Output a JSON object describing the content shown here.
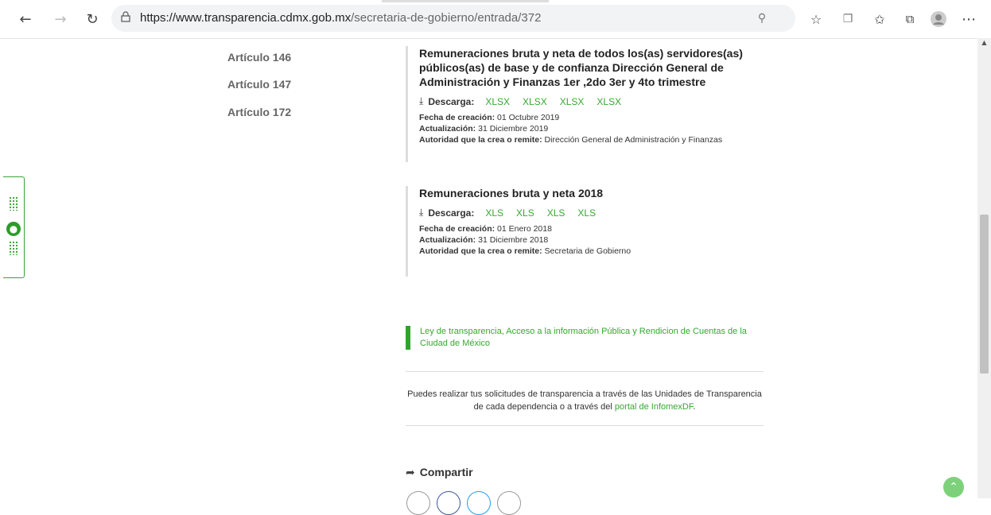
{
  "browser": {
    "url_domain": "https://www.transparencia.cdmx.gob.mx",
    "url_path": "/secretaria-de-gobierno/entrada/372"
  },
  "sidebar": {
    "items": [
      {
        "label": "Artículo 146"
      },
      {
        "label": "Artículo 147"
      },
      {
        "label": "Artículo 172"
      }
    ]
  },
  "documents": [
    {
      "title": "Remuneraciones bruta y neta de todos los(as) servidores(as) públicos(as) de base y de confianza Dirección General de Administración y Finanzas 1er ,2do 3er y 4to trimestre",
      "download_label": "Descarga:",
      "files": [
        "XLSX",
        "XLSX",
        "XLSX",
        "XLSX"
      ],
      "creation_label": "Fecha de creación:",
      "creation_value": "01 Octubre 2019",
      "update_label": "Actualización:",
      "update_value": "31 Diciembre 2019",
      "authority_label": "Autoridad que la crea o remite:",
      "authority_value": "Dirección General de Administración y Finanzas"
    },
    {
      "title": "Remuneraciones bruta y neta 2018",
      "download_label": "Descarga:",
      "files": [
        "XLS",
        "XLS",
        "XLS",
        "XLS"
      ],
      "creation_label": "Fecha de creación:",
      "creation_value": "01 Enero 2018",
      "update_label": "Actualización:",
      "update_value": "31 Diciembre 2018",
      "authority_label": "Autoridad que la crea o remite:",
      "authority_value": "Secretaria de Gobierno"
    }
  ],
  "law": {
    "text": "Ley de transparencia, Acceso a la información Pública y Rendicion de Cuentas de la Ciudad de México"
  },
  "info": {
    "text_before": "Puedes realizar tus solicitudes de transparencia a través de las Unidades de Transparencia de cada dependencia o a través del ",
    "link": "portal de InfomexDF",
    "text_after": "."
  },
  "share": {
    "label": "Compartir"
  },
  "colors": {
    "accent": "#35a830",
    "accent_dark": "#2ea52a"
  }
}
